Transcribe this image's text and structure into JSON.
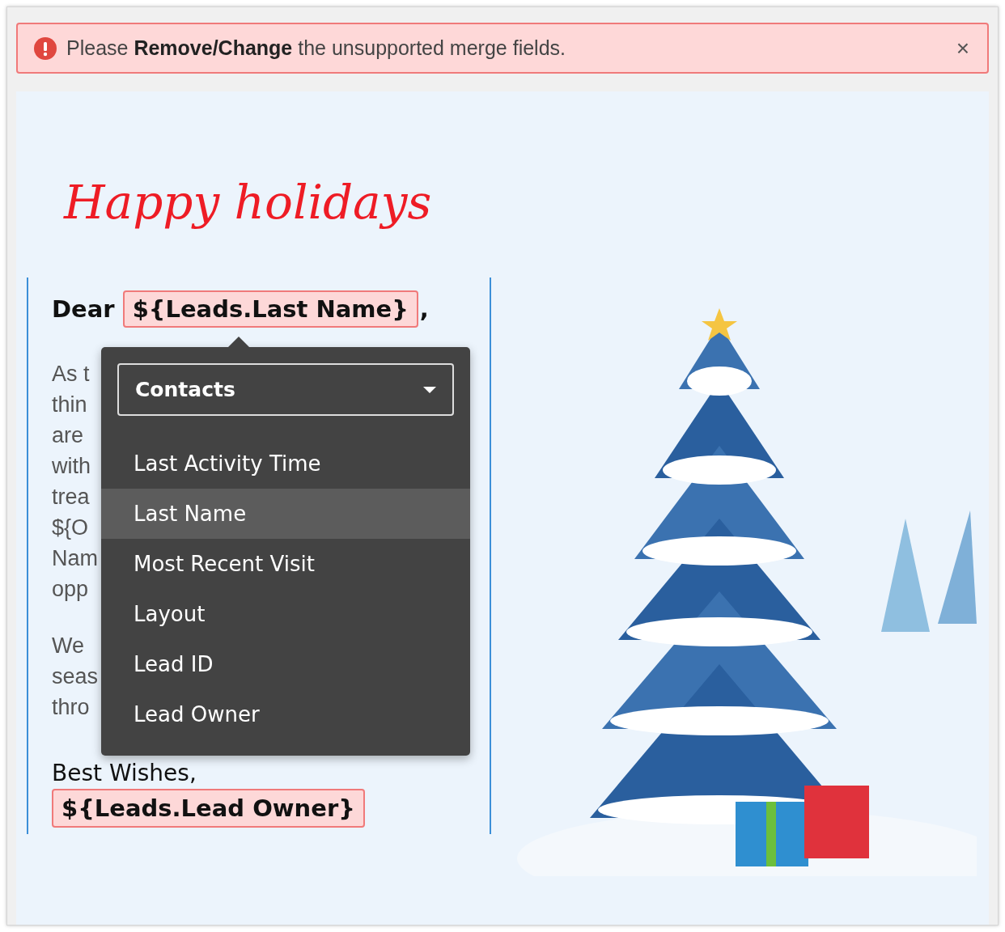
{
  "alert": {
    "message": "Please **Remove/Change** the unsupported merge fields.",
    "close": "×"
  },
  "email": {
    "title": "Happy holidays",
    "greeting": {
      "word": "Dear",
      "merge_field": "${Leads.Last Name}",
      "punctuation": ","
    },
    "paragraphs": [
      [
        "As t",
        "thin",
        "are",
        "with",
        "trea",
        "${O",
        "Nam",
        "opp"
      ],
      [
        "We",
        "seas",
        "thro"
      ]
    ],
    "closing": "Best Wishes,",
    "signature_field": "${Leads.Lead Owner}"
  },
  "field_picker": {
    "module": "Contacts",
    "items": [
      {
        "label": "Last Activity Time",
        "selected": false
      },
      {
        "label": "Last Name",
        "selected": true
      },
      {
        "label": "Most Recent Visit",
        "selected": false
      },
      {
        "label": "Layout",
        "selected": false
      },
      {
        "label": "Lead ID",
        "selected": false
      },
      {
        "label": "Lead Owner",
        "selected": false
      }
    ]
  }
}
